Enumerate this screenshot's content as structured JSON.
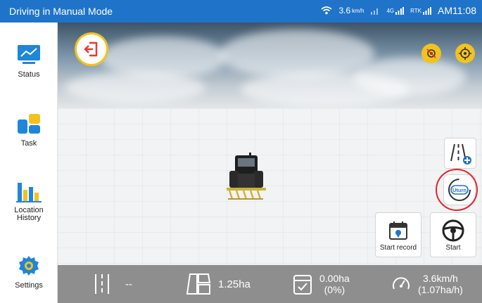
{
  "statusbar": {
    "title": "Driving in Manual Mode",
    "speed_indicator": "3.6",
    "speed_unit": "km/h",
    "signal_badge": "4G",
    "rtk_label": "RTK",
    "time": "AM11:08"
  },
  "sidebar": {
    "items": [
      {
        "label": "Status",
        "icon": "status-chart-icon"
      },
      {
        "label": "Task",
        "icon": "task-blocks-icon"
      },
      {
        "label": "Location\nHistory",
        "icon": "location-history-bars-icon"
      },
      {
        "label": "Settings",
        "icon": "gear-icon"
      }
    ]
  },
  "controls": {
    "start_record_label": "Start record",
    "start_label": "Start",
    "uturn_label": "Uturn"
  },
  "info": {
    "line_value": "--",
    "area_value": "1.25ha",
    "worked_area": "0.00ha",
    "worked_percent": "(0%)",
    "speed": "3.6km/h",
    "rate": "(1.07ha/h)"
  },
  "colors": {
    "statusbar": "#1f74c9",
    "accent_yellow": "#f3c21d",
    "sidebar_icon_blue": "#1f86d9",
    "highlight_red": "#e0262b",
    "infobar": "#8e8e8e"
  }
}
